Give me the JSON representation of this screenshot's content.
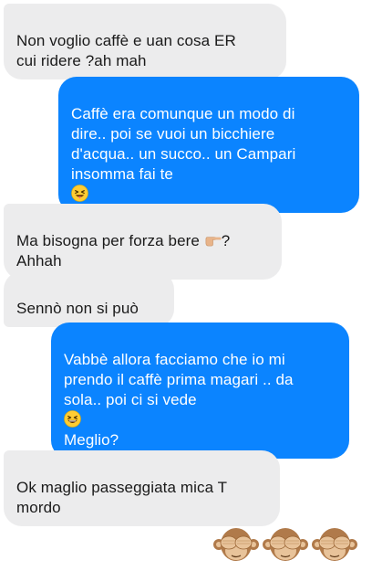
{
  "conversation": {
    "messages": [
      {
        "sender": "received",
        "text": "Non voglio caffè e uan cosa ER\ncui ridere ?ah mah"
      },
      {
        "sender": "sent",
        "text": "Caffè era comunque un modo di\ndire.. poi se vuoi un bicchiere\nd'acqua.. un succo.. un Campari\ninsomma fai te",
        "emoji": "grinning-squinting-tongue"
      },
      {
        "sender": "received",
        "text_before": "Ma bisogna per forza bere ",
        "emoji": "pointing-hand",
        "text_after": "?\nAhhah"
      },
      {
        "sender": "received",
        "text": "Sennò non si può"
      },
      {
        "sender": "sent",
        "text": "Vabbè allora facciamo che io mi\nprendo il caffè prima magari .. da\nsola.. poi ci si vede",
        "emoji": "grinning-squinting",
        "text_after": "\nMeglio?"
      },
      {
        "sender": "received",
        "text": "Ok maglio passeggiata mica T\nmordo"
      }
    ],
    "reaction_emoji": [
      "see-no-evil-monkey",
      "see-no-evil-monkey",
      "see-no-evil-monkey"
    ]
  },
  "colors": {
    "sent_bubble": "#0b84ff",
    "received_bubble": "#ececed",
    "sent_text": "#ffffff",
    "received_text": "#1a1a1a"
  }
}
